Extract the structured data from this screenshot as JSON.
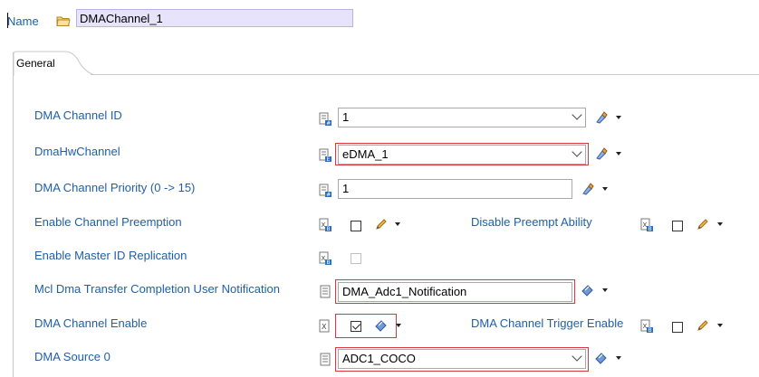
{
  "header": {
    "name_label": "Name",
    "name_value": "DMAChannel_1"
  },
  "tabs": [
    {
      "label": "General"
    }
  ],
  "fields": {
    "dma_channel_id": {
      "label": "DMA Channel ID",
      "value": "1"
    },
    "dma_hw_channel": {
      "label": "DmaHwChannel",
      "value": "eDMA_1"
    },
    "dma_channel_priority": {
      "label": "DMA Channel Priority (0 -> 15)",
      "value": "1"
    },
    "enable_channel_preemption": {
      "label": "Enable Channel Preemption",
      "checked": false
    },
    "disable_preempt_ability": {
      "label": "Disable Preempt Ability",
      "checked": false
    },
    "enable_master_id_replication": {
      "label": "Enable Master ID Replication",
      "checked": false,
      "enabled": false
    },
    "transfer_completion_notification": {
      "label": "Mcl Dma Transfer Completion User Notification",
      "value": "DMA_Adc1_Notification"
    },
    "dma_channel_enable": {
      "label": "DMA Channel Enable",
      "checked": true
    },
    "dma_channel_trigger_enable": {
      "label": "DMA Channel Trigger Enable",
      "checked": false
    },
    "dma_source_0": {
      "label": "DMA Source 0",
      "value": "ADC1_COCO"
    }
  },
  "colors": {
    "label_blue": "#1f5fa8",
    "highlight_red": "#d9363e",
    "name_field_bg": "#e6e3fa"
  },
  "icons": [
    "folder-icon",
    "integer-param-icon",
    "enum-param-icon",
    "boolean-param-icon",
    "string-param-icon",
    "edit-pencil-icon",
    "link-icon"
  ]
}
